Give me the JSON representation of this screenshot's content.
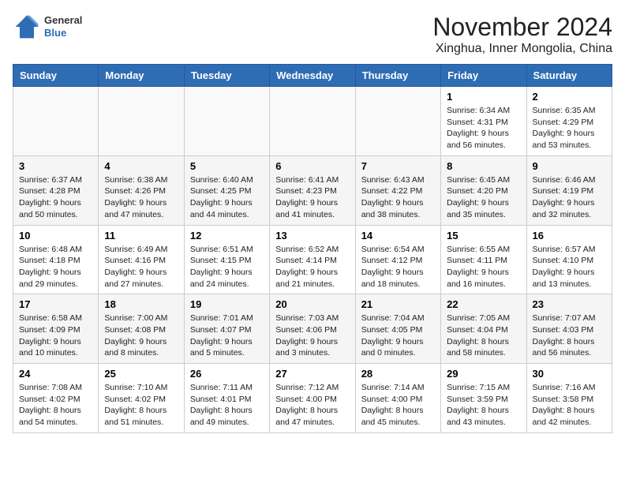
{
  "header": {
    "logo_general": "General",
    "logo_blue": "Blue",
    "month_title": "November 2024",
    "location": "Xinghua, Inner Mongolia, China"
  },
  "days_of_week": [
    "Sunday",
    "Monday",
    "Tuesday",
    "Wednesday",
    "Thursday",
    "Friday",
    "Saturday"
  ],
  "weeks": [
    [
      {
        "day": "",
        "info": ""
      },
      {
        "day": "",
        "info": ""
      },
      {
        "day": "",
        "info": ""
      },
      {
        "day": "",
        "info": ""
      },
      {
        "day": "",
        "info": ""
      },
      {
        "day": "1",
        "info": "Sunrise: 6:34 AM\nSunset: 4:31 PM\nDaylight: 9 hours and 56 minutes."
      },
      {
        "day": "2",
        "info": "Sunrise: 6:35 AM\nSunset: 4:29 PM\nDaylight: 9 hours and 53 minutes."
      }
    ],
    [
      {
        "day": "3",
        "info": "Sunrise: 6:37 AM\nSunset: 4:28 PM\nDaylight: 9 hours and 50 minutes."
      },
      {
        "day": "4",
        "info": "Sunrise: 6:38 AM\nSunset: 4:26 PM\nDaylight: 9 hours and 47 minutes."
      },
      {
        "day": "5",
        "info": "Sunrise: 6:40 AM\nSunset: 4:25 PM\nDaylight: 9 hours and 44 minutes."
      },
      {
        "day": "6",
        "info": "Sunrise: 6:41 AM\nSunset: 4:23 PM\nDaylight: 9 hours and 41 minutes."
      },
      {
        "day": "7",
        "info": "Sunrise: 6:43 AM\nSunset: 4:22 PM\nDaylight: 9 hours and 38 minutes."
      },
      {
        "day": "8",
        "info": "Sunrise: 6:45 AM\nSunset: 4:20 PM\nDaylight: 9 hours and 35 minutes."
      },
      {
        "day": "9",
        "info": "Sunrise: 6:46 AM\nSunset: 4:19 PM\nDaylight: 9 hours and 32 minutes."
      }
    ],
    [
      {
        "day": "10",
        "info": "Sunrise: 6:48 AM\nSunset: 4:18 PM\nDaylight: 9 hours and 29 minutes."
      },
      {
        "day": "11",
        "info": "Sunrise: 6:49 AM\nSunset: 4:16 PM\nDaylight: 9 hours and 27 minutes."
      },
      {
        "day": "12",
        "info": "Sunrise: 6:51 AM\nSunset: 4:15 PM\nDaylight: 9 hours and 24 minutes."
      },
      {
        "day": "13",
        "info": "Sunrise: 6:52 AM\nSunset: 4:14 PM\nDaylight: 9 hours and 21 minutes."
      },
      {
        "day": "14",
        "info": "Sunrise: 6:54 AM\nSunset: 4:12 PM\nDaylight: 9 hours and 18 minutes."
      },
      {
        "day": "15",
        "info": "Sunrise: 6:55 AM\nSunset: 4:11 PM\nDaylight: 9 hours and 16 minutes."
      },
      {
        "day": "16",
        "info": "Sunrise: 6:57 AM\nSunset: 4:10 PM\nDaylight: 9 hours and 13 minutes."
      }
    ],
    [
      {
        "day": "17",
        "info": "Sunrise: 6:58 AM\nSunset: 4:09 PM\nDaylight: 9 hours and 10 minutes."
      },
      {
        "day": "18",
        "info": "Sunrise: 7:00 AM\nSunset: 4:08 PM\nDaylight: 9 hours and 8 minutes."
      },
      {
        "day": "19",
        "info": "Sunrise: 7:01 AM\nSunset: 4:07 PM\nDaylight: 9 hours and 5 minutes."
      },
      {
        "day": "20",
        "info": "Sunrise: 7:03 AM\nSunset: 4:06 PM\nDaylight: 9 hours and 3 minutes."
      },
      {
        "day": "21",
        "info": "Sunrise: 7:04 AM\nSunset: 4:05 PM\nDaylight: 9 hours and 0 minutes."
      },
      {
        "day": "22",
        "info": "Sunrise: 7:05 AM\nSunset: 4:04 PM\nDaylight: 8 hours and 58 minutes."
      },
      {
        "day": "23",
        "info": "Sunrise: 7:07 AM\nSunset: 4:03 PM\nDaylight: 8 hours and 56 minutes."
      }
    ],
    [
      {
        "day": "24",
        "info": "Sunrise: 7:08 AM\nSunset: 4:02 PM\nDaylight: 8 hours and 54 minutes."
      },
      {
        "day": "25",
        "info": "Sunrise: 7:10 AM\nSunset: 4:02 PM\nDaylight: 8 hours and 51 minutes."
      },
      {
        "day": "26",
        "info": "Sunrise: 7:11 AM\nSunset: 4:01 PM\nDaylight: 8 hours and 49 minutes."
      },
      {
        "day": "27",
        "info": "Sunrise: 7:12 AM\nSunset: 4:00 PM\nDaylight: 8 hours and 47 minutes."
      },
      {
        "day": "28",
        "info": "Sunrise: 7:14 AM\nSunset: 4:00 PM\nDaylight: 8 hours and 45 minutes."
      },
      {
        "day": "29",
        "info": "Sunrise: 7:15 AM\nSunset: 3:59 PM\nDaylight: 8 hours and 43 minutes."
      },
      {
        "day": "30",
        "info": "Sunrise: 7:16 AM\nSunset: 3:58 PM\nDaylight: 8 hours and 42 minutes."
      }
    ]
  ]
}
